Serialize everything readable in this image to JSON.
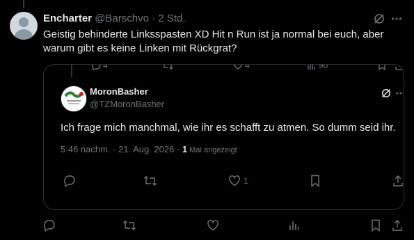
{
  "tweet": {
    "author_name": "Encharter",
    "author_handle": "@Barschvo",
    "separator": "·",
    "time": "2 Std.",
    "text": "Geistig behinderte Linksspasten XD Hit n Run ist ja normal bei  euch, aber warum gibt es keine Linken mit Rückgrat?"
  },
  "quoted_partial_actions": {
    "replies": "4",
    "likes": "4",
    "views": "90"
  },
  "quoted": {
    "author_name": "MoronBasher",
    "author_handle": "@TZMoronBasher",
    "text": "Ich frage mich manchmal, wie ihr es schafft zu atmen. So dumm seid ihr.",
    "timestamp": "5:46 nachm. · 21. Aug. 2026 · ",
    "views_count": "1",
    "views_label": " Mal angezeigt",
    "likes": "1"
  },
  "icons": [
    "grok-icon",
    "more-icon",
    "reply-icon",
    "retweet-icon",
    "like-icon",
    "views-icon",
    "bookmark-icon",
    "share-icon"
  ],
  "colors": {
    "background": "#000000",
    "text": "#e7e9ea",
    "muted": "#71767b",
    "border": "#2f3336"
  }
}
